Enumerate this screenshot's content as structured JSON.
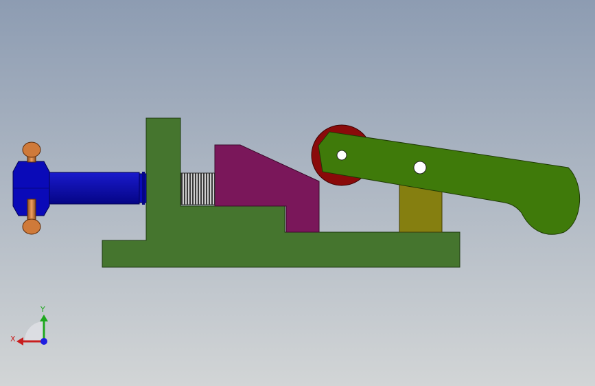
{
  "scene": {
    "background_top": "#8d9cb2",
    "background_bottom": "#d2d5d6"
  },
  "parts": {
    "base_frame": {
      "color": "#45752e"
    },
    "slider_block": {
      "color": "#7a175a"
    },
    "screw_handle": {
      "color": "#0a0ab8",
      "dark": "#050585"
    },
    "handle_pins": {
      "color": "#cf7a3a",
      "dark": "#8a4a1a"
    },
    "thread": {
      "color": "#7a7a7a"
    },
    "lever_arm": {
      "color": "#3f7a0a"
    },
    "support_link": {
      "color": "#857f10"
    },
    "roller": {
      "color": "#8a0a0a"
    },
    "pin_hole": {
      "color": "#ffffff"
    }
  },
  "triad": {
    "x_label": "X",
    "y_label": "Y",
    "x_color": "#c81e1e",
    "y_color": "#1ea81e",
    "z_color": "#1e1ee0"
  }
}
